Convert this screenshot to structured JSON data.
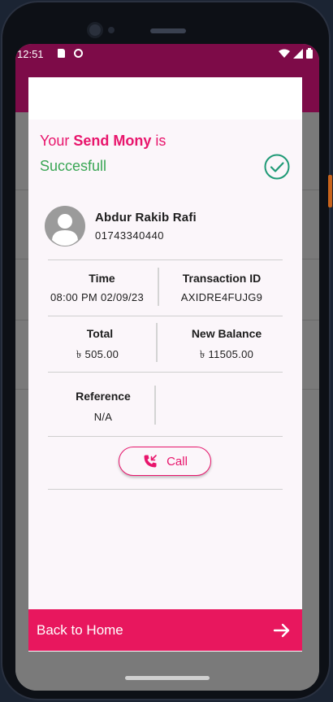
{
  "status_bar": {
    "time": "12:51"
  },
  "dialog": {
    "title_prefix": "Your",
    "title_highlight": "Send Mony",
    "title_suffix": "is",
    "status": "Succesfull"
  },
  "recipient": {
    "name": "Abdur Rakib Rafi",
    "phone": "01743340440"
  },
  "details": {
    "time_label": "Time",
    "time_value": "08:00 PM 02/09/23",
    "txn_label": "Transaction ID",
    "txn_value": "AXIDRE4FUJG9",
    "total_label": "Total",
    "total_value": "৳ 505.00",
    "balance_label": "New Balance",
    "balance_value": "৳ 11505.00",
    "reference_label": "Reference",
    "reference_value": "N/A"
  },
  "actions": {
    "call_label": "Call",
    "home_label": "Back to Home"
  },
  "colors": {
    "accent": "#e8156c",
    "success": "#3aa655",
    "appbar": "#7d0b48",
    "home_button": "#e8175e"
  }
}
